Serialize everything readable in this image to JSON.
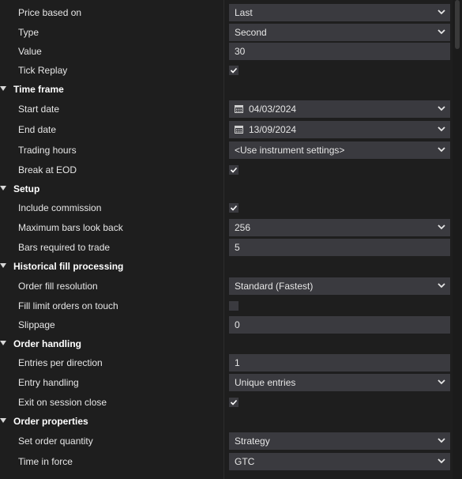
{
  "rows": {
    "price_based_on": {
      "label": "Price based on",
      "value": "Last"
    },
    "type": {
      "label": "Type",
      "value": "Second"
    },
    "value": {
      "label": "Value",
      "value": "30"
    },
    "tick_replay": {
      "label": "Tick Replay",
      "checked": true
    },
    "time_frame": {
      "label": "Time frame"
    },
    "start_date": {
      "label": "Start date",
      "value": "04/03/2024"
    },
    "end_date": {
      "label": "End date",
      "value": "13/09/2024"
    },
    "trading_hours": {
      "label": "Trading hours",
      "value": "<Use instrument settings>"
    },
    "break_at_eod": {
      "label": "Break at EOD",
      "checked": true
    },
    "setup": {
      "label": "Setup"
    },
    "include_commission": {
      "label": "Include commission",
      "checked": true
    },
    "max_bars_look_back": {
      "label": "Maximum bars look back",
      "value": "256"
    },
    "bars_required": {
      "label": "Bars required to trade",
      "value": "5"
    },
    "historical_fill": {
      "label": "Historical fill processing"
    },
    "order_fill_resolution": {
      "label": "Order fill resolution",
      "value": "Standard (Fastest)"
    },
    "fill_limit_orders": {
      "label": "Fill limit orders on touch",
      "checked": false
    },
    "slippage": {
      "label": "Slippage",
      "value": "0"
    },
    "order_handling": {
      "label": "Order handling"
    },
    "entries_per_direction": {
      "label": "Entries per direction",
      "value": "1"
    },
    "entry_handling": {
      "label": "Entry handling",
      "value": "Unique entries"
    },
    "exit_on_session_close": {
      "label": "Exit on session close",
      "checked": true
    },
    "order_properties": {
      "label": "Order properties"
    },
    "set_order_quantity": {
      "label": "Set order quantity",
      "value": "Strategy"
    },
    "time_in_force": {
      "label": "Time in force",
      "value": "GTC"
    }
  },
  "icons": {
    "dropdown": "chevron-down-icon",
    "calendar": "calendar-icon",
    "check": "checkmark-icon",
    "collapse": "triangle-down-icon"
  },
  "colors": {
    "background": "#1e1e1e",
    "field": "#3a3a3f",
    "text": "#e6e6e6"
  }
}
